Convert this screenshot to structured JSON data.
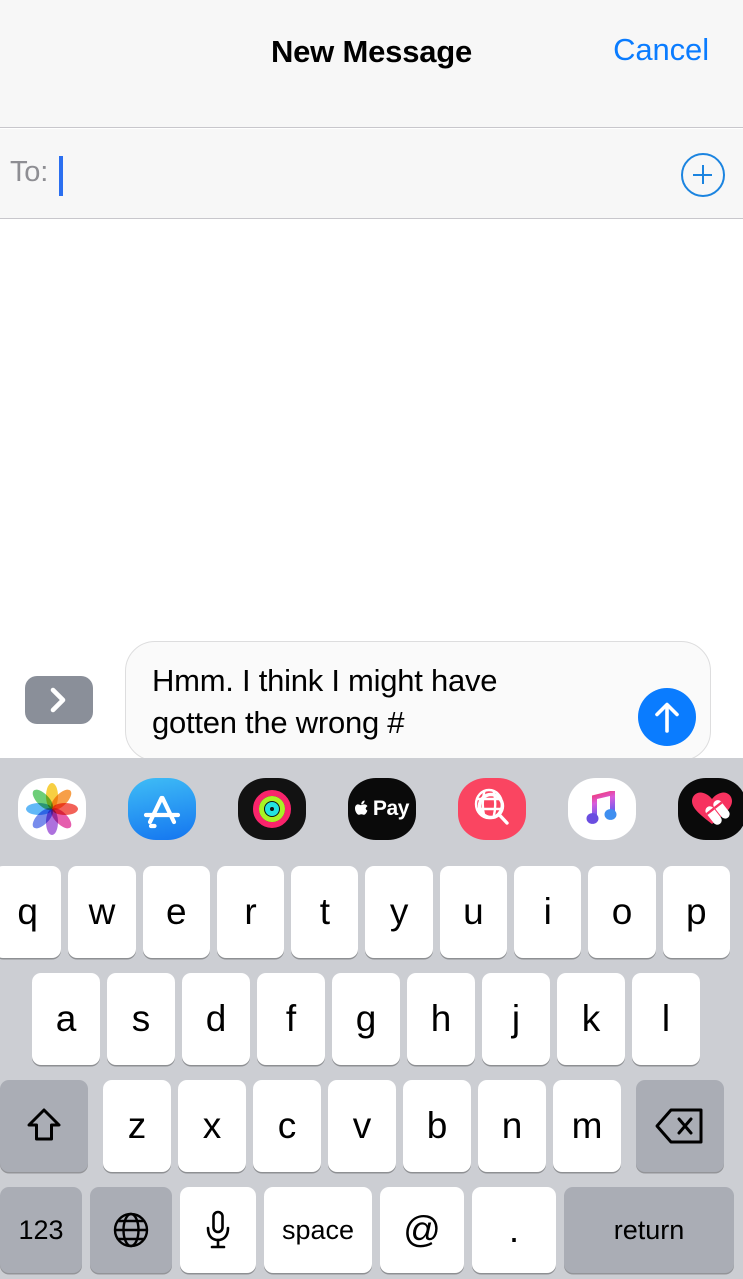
{
  "app": "Messages",
  "navbar": {
    "title": "New Message",
    "cancel_label": "Cancel"
  },
  "recipient_field": {
    "label": "To:",
    "value": "",
    "placeholder": "",
    "add_contact_icon": "plus-circle-icon",
    "caret_color": "#2b6ff0"
  },
  "compose": {
    "expand_icon": "chevron-right-icon",
    "message_text": "Hmm. I think I might have\ngotten the wrong #",
    "send_icon": "arrow-up-icon",
    "send_color": "#0a7cff"
  },
  "app_drawer": {
    "items": [
      {
        "name": "photos-icon",
        "label": "Photos"
      },
      {
        "name": "app-store-icon",
        "label": "App Store"
      },
      {
        "name": "activity-icon",
        "label": "Activity"
      },
      {
        "name": "apple-pay-icon",
        "label": "Pay"
      },
      {
        "name": "images-search-icon",
        "label": "#images"
      },
      {
        "name": "apple-music-icon",
        "label": "Music"
      },
      {
        "name": "digital-touch-icon",
        "label": "Digital Touch"
      }
    ]
  },
  "keyboard": {
    "row1": [
      "q",
      "w",
      "e",
      "r",
      "t",
      "y",
      "u",
      "i",
      "o",
      "p"
    ],
    "row2": [
      "a",
      "s",
      "d",
      "f",
      "g",
      "h",
      "j",
      "k",
      "l"
    ],
    "row3": {
      "shift": "shift-icon",
      "letters": [
        "z",
        "x",
        "c",
        "v",
        "b",
        "n",
        "m"
      ],
      "backspace": "backspace-icon"
    },
    "row4": {
      "numbers_label": "123",
      "globe_icon": "globe-icon",
      "mic_icon": "microphone-icon",
      "space_label": "space",
      "at_label": "@",
      "period_label": ".",
      "return_label": "return"
    }
  },
  "colors": {
    "accent": "#0a7cff",
    "nav_background": "#f7f7f7",
    "keyboard_background": "#ccced3",
    "key_face": "#ffffff",
    "key_dark": "#aaadb5",
    "bubble_fill": "#fafafa",
    "bubble_border": "#ddddde",
    "label_gray": "#8e8e93"
  }
}
